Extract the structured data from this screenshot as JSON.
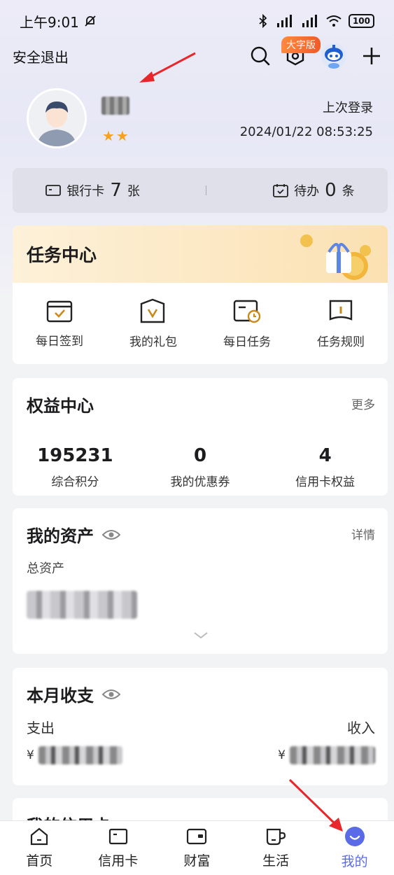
{
  "status_bar": {
    "time": "上午9:01",
    "battery": "100"
  },
  "header": {
    "logout": "安全退出",
    "big_font_badge": "大字版"
  },
  "profile": {
    "stars": "★★",
    "last_login_label": "上次登录",
    "last_login_time": "2024/01/22 08:53:25"
  },
  "summary": {
    "bank_card_label": "银行卡",
    "bank_card_count": "7",
    "bank_card_unit": "张",
    "todo_label": "待办",
    "todo_count": "0",
    "todo_unit": "条"
  },
  "task_center": {
    "title": "任务中心",
    "items": [
      {
        "label": "每日签到",
        "icon": "checkin-icon"
      },
      {
        "label": "我的礼包",
        "icon": "gift-bag-icon"
      },
      {
        "label": "每日任务",
        "icon": "daily-task-icon"
      },
      {
        "label": "任务规则",
        "icon": "rules-book-icon"
      }
    ]
  },
  "rights_center": {
    "title": "权益中心",
    "more": "更多",
    "items": [
      {
        "value": "195231",
        "label": "综合积分"
      },
      {
        "value": "0",
        "label": "我的优惠券"
      },
      {
        "value": "4",
        "label": "信用卡权益"
      }
    ]
  },
  "assets": {
    "title": "我的资产",
    "more": "详情",
    "total_label": "总资产"
  },
  "monthly": {
    "title": "本月收支",
    "expense_label": "支出",
    "income_label": "收入",
    "currency": "¥"
  },
  "credit_section": {
    "title": "我的信用卡"
  },
  "tabbar": {
    "tabs": [
      {
        "label": "首页",
        "icon": "home-icon"
      },
      {
        "label": "信用卡",
        "icon": "credit-card-icon"
      },
      {
        "label": "财富",
        "icon": "wallet-icon"
      },
      {
        "label": "生活",
        "icon": "cup-icon"
      },
      {
        "label": "我的",
        "icon": "smile-icon",
        "active": true
      }
    ]
  },
  "colors": {
    "accent": "#5b6be8",
    "task_gold": "#c98a1a",
    "annotation_arrow": "#e8262b"
  }
}
